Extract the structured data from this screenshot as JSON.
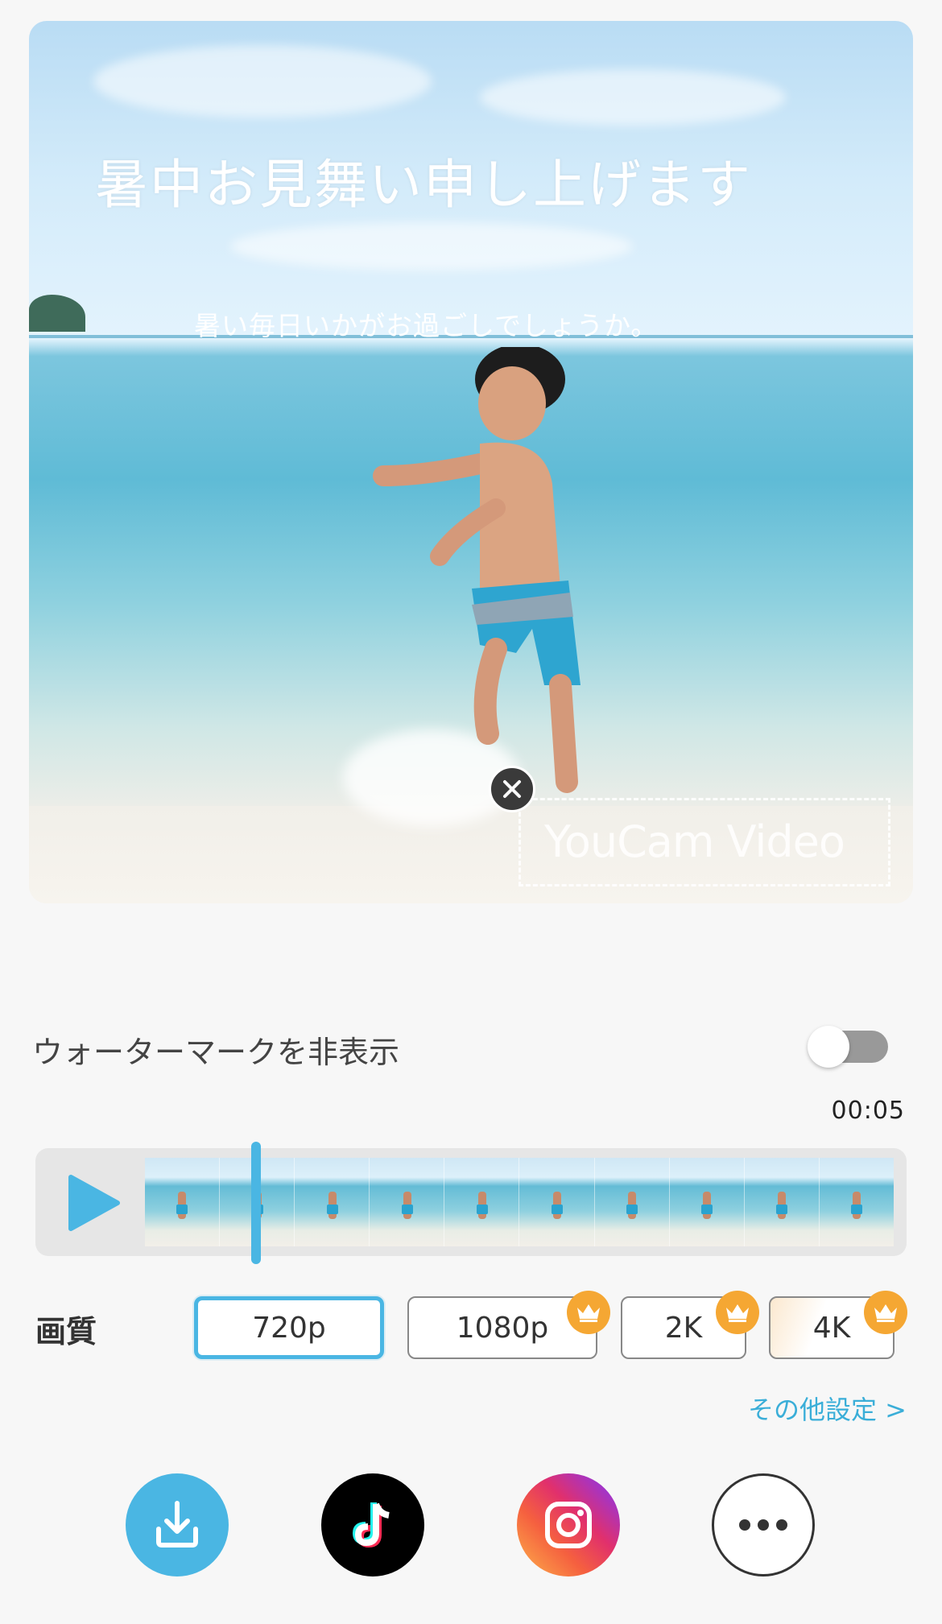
{
  "preview": {
    "greeting": "暑中お見舞い申し上げます",
    "subtext": "暑い毎日いかがお過ごしでしょうか。",
    "watermark": "YouCam Video"
  },
  "watermark_toggle": {
    "label": "ウォーターマークを非表示",
    "enabled": false
  },
  "timeline": {
    "duration": "00:05",
    "frame_count": 10
  },
  "quality": {
    "label": "画質",
    "options": [
      "720p",
      "1080p",
      "2K",
      "4K"
    ],
    "selected": "720p",
    "premium": [
      "1080p",
      "2K",
      "4K"
    ]
  },
  "more_settings": "その他設定 >",
  "share_buttons": [
    "download-icon",
    "tiktok-icon",
    "instagram-icon",
    "more-icon"
  ],
  "colors": {
    "accent": "#4ab6e3",
    "premium_crown": "#f5a733",
    "link": "#3aaed8"
  }
}
